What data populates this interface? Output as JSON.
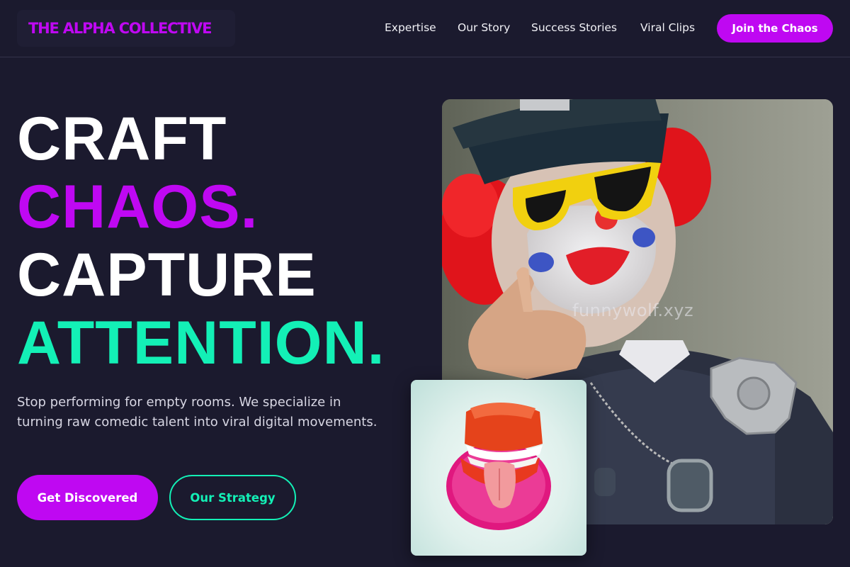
{
  "brand": {
    "name": "THE ALPHA COLLECTIVE",
    "color": "#bf08f2"
  },
  "nav": {
    "links": [
      "Expertise",
      "Our Story",
      "Success Stories",
      "Viral Clips"
    ],
    "cta": "Join the Chaos"
  },
  "hero": {
    "line1": "CRAFT",
    "line2": "CHAOS.",
    "line3": "CAPTURE",
    "line4": "ATTENTION.",
    "subtext": "Stop performing for empty rooms. We specialize in turning raw comedic talent into viral digital movements.",
    "primary_button": "Get Discovered",
    "secondary_button": "Our Strategy"
  },
  "images": {
    "main": {
      "icon": "clown-police-officer-photo",
      "watermark": "funnywolf.xyz"
    },
    "secondary": {
      "icon": "wind-up-chattering-teeth-photo"
    }
  },
  "colors": {
    "background": "#1b1a2e",
    "accent_purple": "#bf08f2",
    "accent_teal": "#13f0b6",
    "text": "#ffffff"
  }
}
